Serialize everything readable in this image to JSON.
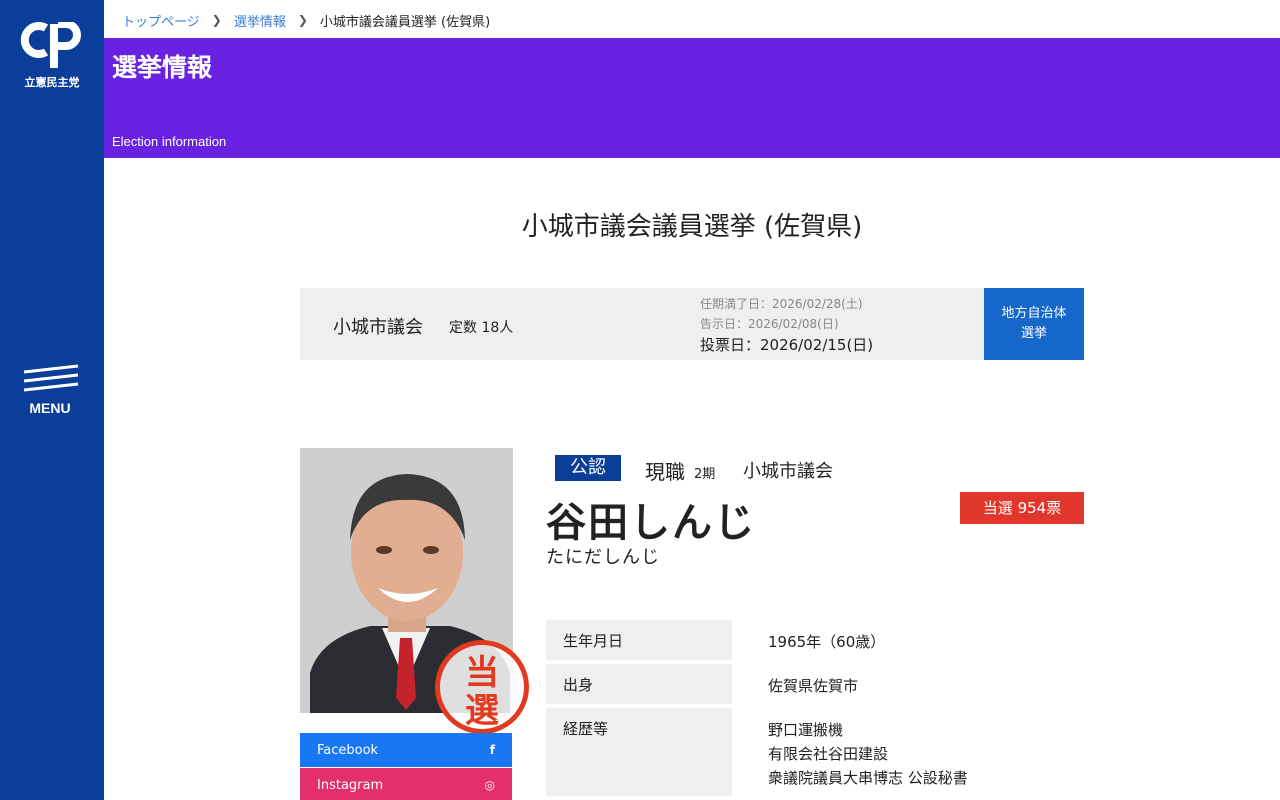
{
  "sidebar": {
    "logo_text": "立憲民主党",
    "menu_label": "MENU",
    "colors": {
      "background": "#0b3e99"
    }
  },
  "breadcrumb": {
    "items": [
      {
        "label": "トップページ"
      },
      {
        "label": "選挙情報"
      }
    ],
    "current": "小城市議会議員選挙 (佐賀県)"
  },
  "header": {
    "title": "選挙情報",
    "subtitle": "Election information",
    "colors": {
      "background": "#6a22e2"
    }
  },
  "page_title": "小城市議会議員選挙 (佐賀県)",
  "election": {
    "council": "小城市議会",
    "seats": "定数 18人",
    "term_end": "任期満了日：2026/02/28(土)",
    "announce": "告示日：2026/02/08(日)",
    "voting_day": "投票日：2026/02/15(日)",
    "type_button": "地方自治体\n選挙"
  },
  "candidate": {
    "tag": "公認",
    "status": "現職",
    "term": "2期",
    "council": "小城市議会",
    "name": "谷田しんじ",
    "kana": "たにだしんじ",
    "result": "当選 954票",
    "stamp": [
      "当",
      "選"
    ],
    "sns": [
      {
        "label": "Facebook",
        "icon": "f"
      },
      {
        "label": "Instagram",
        "icon": "◎"
      }
    ],
    "profile": [
      {
        "key": "生年月日",
        "value": "1965年（60歳）"
      },
      {
        "key": "出身",
        "value": "佐賀県佐賀市"
      },
      {
        "key": "経歴等",
        "lines": [
          "野口運搬機",
          "有限会社谷田建設",
          "衆議院議員大串博志 公設秘書"
        ]
      }
    ]
  }
}
